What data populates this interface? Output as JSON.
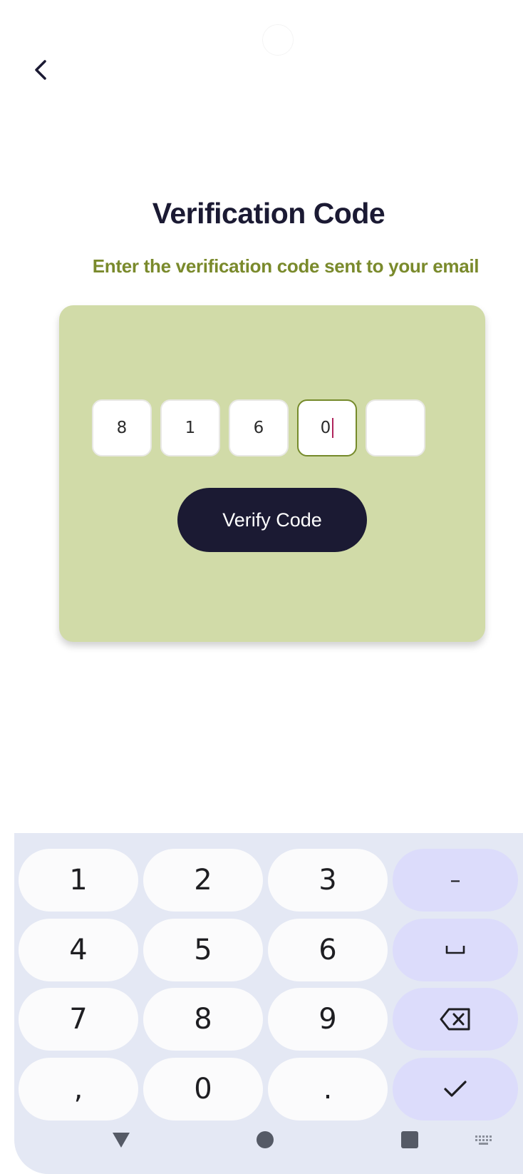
{
  "screen": {
    "title": "Verification Code",
    "subtitle": "Enter the verification code sent to your email"
  },
  "code": {
    "digits": [
      "8",
      "1",
      "6",
      "0",
      ""
    ],
    "active_index": 3
  },
  "verify_button": {
    "label": "Verify Code"
  },
  "keyboard": {
    "keys": {
      "k1": "1",
      "k2": "2",
      "k3": "3",
      "k4": "4",
      "k5": "5",
      "k6": "6",
      "k7": "7",
      "k8": "8",
      "k9": "9",
      "comma": ",",
      "k0": "0",
      "period": ".",
      "dash": "–",
      "space": "␣"
    },
    "action_keys": [
      "dash",
      "space",
      "backspace-icon",
      "check-icon"
    ]
  },
  "nav_bar": {
    "icons": [
      "back-triangle-icon",
      "home-circle-icon",
      "recents-square-icon",
      "keyboard-switch-icon"
    ]
  },
  "colors": {
    "title": "#1b1a33",
    "subtitle": "#7a8a2c",
    "card": "#d1dba8",
    "button": "#1b1a33",
    "active_border": "#758a2a",
    "caret": "#b0245c",
    "keyboard_bg": "#e4e8f4",
    "action_key": "#dcdcfb"
  },
  "icons": {
    "back": "chevron-left-icon"
  }
}
